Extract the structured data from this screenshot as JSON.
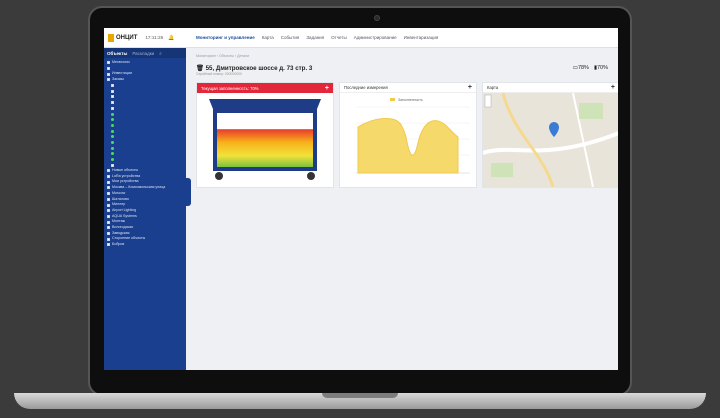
{
  "app": {
    "logo": "ОНЦИТ",
    "clock": "17:11:25"
  },
  "nav": [
    "Мониторинг и управление",
    "Карта",
    "События",
    "Задания",
    "Отчеты",
    "Администрирование",
    "Инвентаризация"
  ],
  "sidebar": {
    "tab_objects": "Объекты",
    "tab_groups": "Раскладки",
    "items": [
      "Мегаполис",
      "",
      "Инвестиции",
      "Заказы",
      "",
      "",
      "",
      "",
      "",
      "",
      "",
      "",
      "",
      "",
      "",
      "",
      "",
      "",
      "",
      "Новые объекты",
      "LoRa устройства",
      "Мои устройства",
      "Москва – Комсомольская улица",
      "Moscow",
      "Шаталово",
      "Миллер",
      "Airport Lighting",
      "AQUA Systems",
      "Монтаж",
      "Вологодская",
      "Заводская",
      "Сторонние объекты",
      "Бобров"
    ]
  },
  "main": {
    "breadcrumb": "Мониторинг › Объекты › Детали",
    "title": "55, Дмитровское шоссе д. 73 стр. 3",
    "subtitle": "Серийный номер: 000000000",
    "battery_label": "78%",
    "fill_label": "70%"
  },
  "cards": {
    "fill": {
      "title": "Текущая заполненность: 70%",
      "level": 0.7
    },
    "measurements": {
      "title": "Последние измерения",
      "legend": "Заполненность"
    },
    "map": {
      "title": "Карта"
    }
  },
  "colors": {
    "sidebar": "#1b3f8f",
    "accent": "#1f4fa3",
    "alert": "#e3273a",
    "chart_fill": "#f2c94c"
  }
}
